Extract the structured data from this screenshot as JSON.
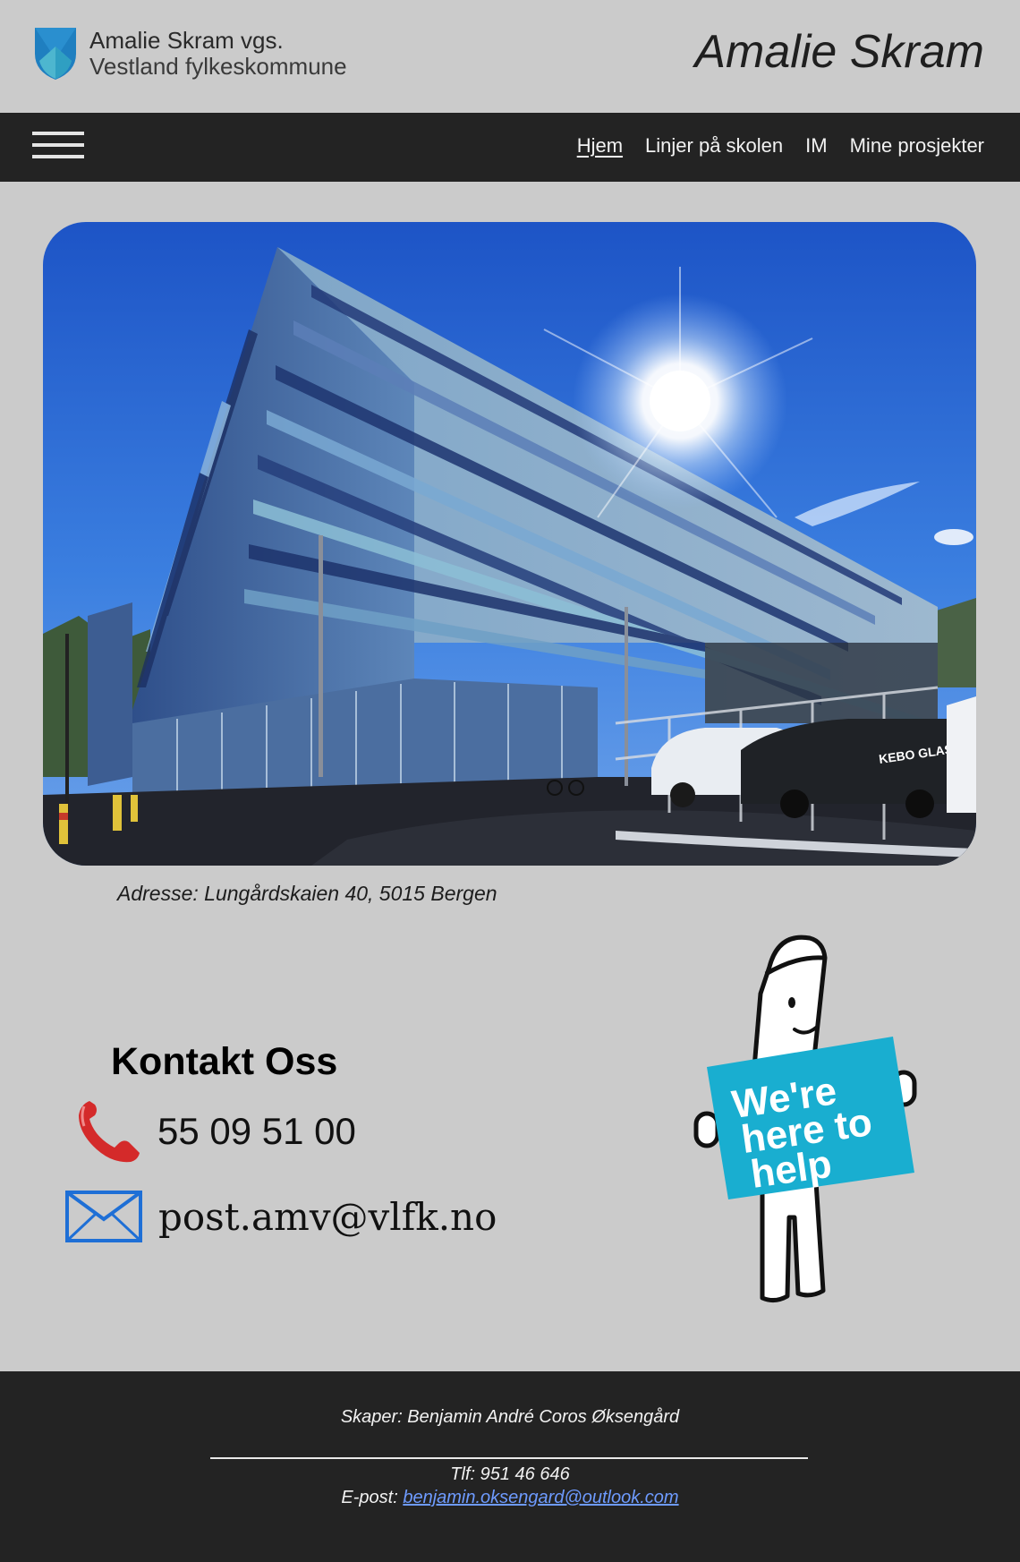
{
  "header": {
    "logo_line1": "Amalie Skram vgs.",
    "logo_line2": "Vestland fylkeskommune",
    "site_title": "Amalie Skram"
  },
  "nav": {
    "menu_icon": "hamburger-menu-icon",
    "links": [
      {
        "label": "Hjem",
        "active": true
      },
      {
        "label": "Linjer på skolen",
        "active": false
      },
      {
        "label": "IM",
        "active": false
      },
      {
        "label": "Mine prosjekter",
        "active": false
      }
    ]
  },
  "hero": {
    "address": "Adresse: Lungårdskaien 40, 5015 Bergen",
    "building_sign": "KEBO GLASS"
  },
  "contact": {
    "title": "Kontakt Oss",
    "phone_icon": "telephone-receiver-icon",
    "phone": "55 09 51 00",
    "mail_icon": "envelope-icon",
    "email": "post.amv@vlfk.no",
    "helper_sign": [
      "We're",
      "here to",
      "help"
    ]
  },
  "footer": {
    "creator": "Skaper: Benjamin André Coros Øksengård",
    "phone": "Tlf: 951 46 646",
    "email_label": "E-post:",
    "email": "benjamin.oksengard@outlook.com"
  },
  "colors": {
    "background": "#cbcbcb",
    "nav_background": "#232323",
    "footer_background": "#232323",
    "link_blue": "#6e9bff",
    "logo_blue": "#1f7fc0",
    "logo_teal": "#3aa8c8",
    "helper_sign": "#19aed0",
    "mail_icon_blue": "#1e6fd6",
    "phone_icon_red": "#d42a2a"
  }
}
